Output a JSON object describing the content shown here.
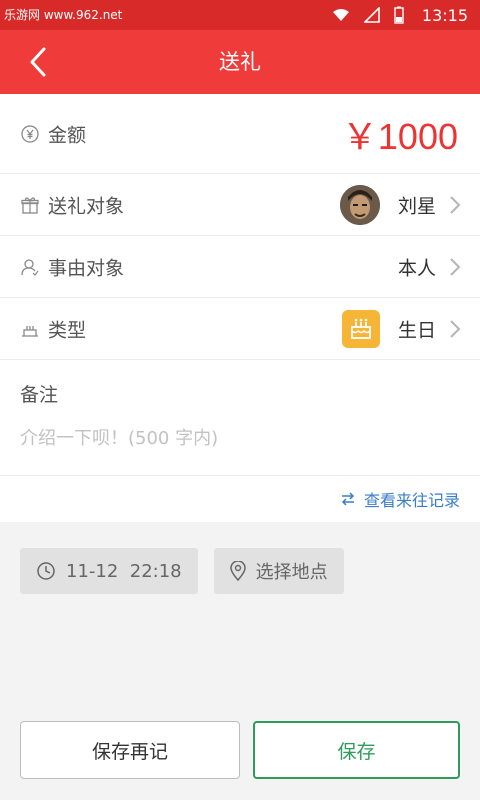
{
  "status_bar": {
    "watermark": "乐游网 www.962.net",
    "time": "13:15"
  },
  "navbar": {
    "title": "送礼"
  },
  "form": {
    "amount": {
      "label": "金额",
      "value": "￥1000"
    },
    "recipient": {
      "label": "送礼对象",
      "value": "刘星"
    },
    "reason_target": {
      "label": "事由对象",
      "value": "本人"
    },
    "type": {
      "label": "类型",
      "value": "生日"
    },
    "notes": {
      "label": "备注",
      "placeholder": "介绍一下呗！(500 字内)"
    },
    "history_link": "查看来往记录"
  },
  "chips": {
    "datetime": "11-12  22:18",
    "location": "选择地点"
  },
  "buttons": {
    "save_and_continue": "保存再记",
    "save": "保存"
  },
  "colors": {
    "nav": "#f03b3b",
    "status": "#d92a2a",
    "amount": "#ee3333",
    "link": "#3a7ec9",
    "save": "#2e9b5a",
    "cake": "#f7b538"
  }
}
